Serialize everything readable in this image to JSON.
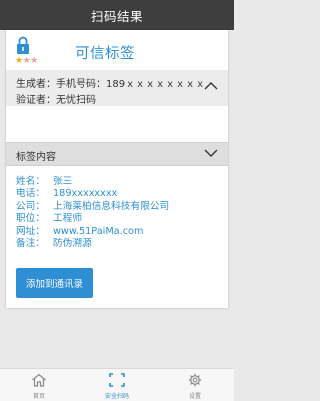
{
  "header": {
    "title": "扫码结果"
  },
  "card": {
    "title": "可信标签",
    "rating": {
      "filled": 1,
      "total": 3
    },
    "generator_label": "生成者：",
    "generator_value": "手机号码：189ｘｘｘｘｘｘｘｘ",
    "verifier_label": "验证者：",
    "verifier_value": "无忧扫码",
    "section_title": "标签内容",
    "fields": [
      {
        "key": "姓名：",
        "value": "张三"
      },
      {
        "key": "电话：",
        "value": "189xxxxxxxx"
      },
      {
        "key": "公司：",
        "value": "上海莱柏信息科技有限公司"
      },
      {
        "key": "职位：",
        "value": "工程师"
      },
      {
        "key": "网址：",
        "value": "www.51PaiMa.com"
      },
      {
        "key": "备注：",
        "value": "防伪溯源"
      }
    ],
    "add_button": "添加到通讯录"
  },
  "tabbar": {
    "items": [
      {
        "label": "首页",
        "icon": "home-icon"
      },
      {
        "label": "安全扫码",
        "icon": "scan-icon"
      },
      {
        "label": "设置",
        "icon": "gear-icon"
      }
    ],
    "active_index": 1
  },
  "colors": {
    "accent": "#2f8fd4",
    "topbar": "#3e3e3e",
    "star": "#f0a71c"
  }
}
